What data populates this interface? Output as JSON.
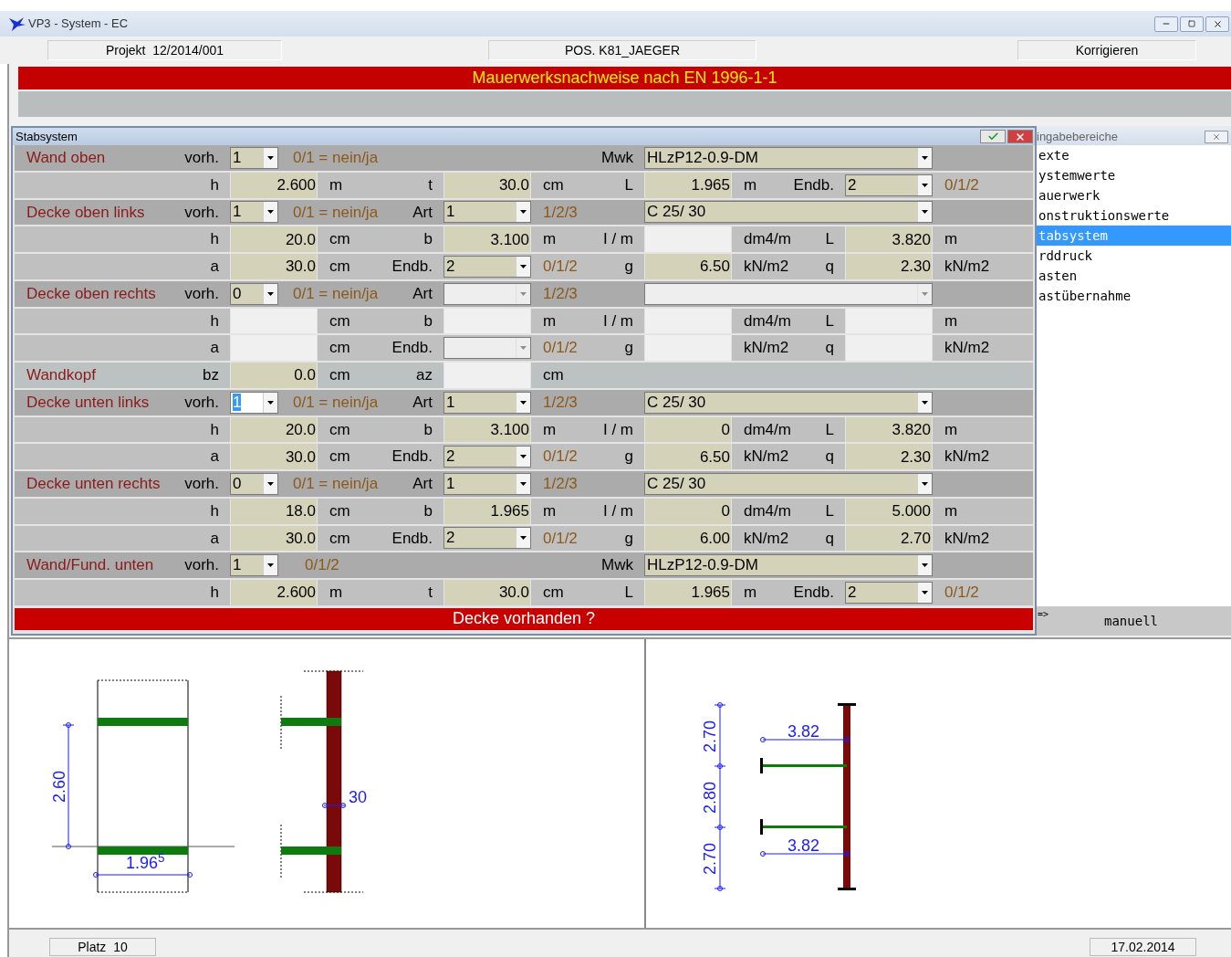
{
  "window": {
    "title": "VP3 - System - EC"
  },
  "info_fields": [
    "Projekt  12/2014/001",
    "POS. K81_JAEGER",
    "Korrigieren"
  ],
  "banner": "Mauerwerksnachweise nach EN 1996-1-1",
  "form": {
    "title": "Stabsystem",
    "rows": [
      {
        "kind": "header",
        "cells": [
          {
            "kind": "caption",
            "title": "Wand oben",
            "label": "vorh."
          },
          {
            "kind": "flag",
            "value": "1",
            "enabled": true,
            "focused": false
          },
          {
            "kind": "text",
            "hint": "0/1 = nein/ja"
          },
          {
            "kind": "blank"
          },
          {
            "kind": "text",
            "label": "Mwk"
          },
          {
            "kind": "material",
            "value": "HLzP12-0.9-DM",
            "enabled": true
          },
          {
            "kind": "blank"
          }
        ]
      },
      {
        "kind": "values",
        "cells": [
          {
            "kind": "caption",
            "label": "h"
          },
          {
            "kind": "input",
            "value": "2.600",
            "enabled": true
          },
          {
            "kind": "text",
            "unit": "m",
            "label": "t"
          },
          {
            "kind": "input",
            "value": "30.0",
            "enabled": true
          },
          {
            "kind": "text",
            "unit": "cm",
            "label": "L"
          },
          {
            "kind": "input",
            "value": "1.965",
            "enabled": true
          },
          {
            "kind": "text",
            "unit": "m",
            "label": "Endb."
          },
          {
            "kind": "combo",
            "value": "2",
            "enabled": true
          },
          {
            "kind": "text",
            "hint": "0/1/2"
          }
        ]
      },
      {
        "kind": "header",
        "cells": [
          {
            "kind": "caption",
            "title": "Decke oben links",
            "label": "vorh."
          },
          {
            "kind": "flag",
            "value": "1",
            "enabled": true,
            "focused": false
          },
          {
            "kind": "text",
            "hint": "0/1 = nein/ja",
            "label": "Art"
          },
          {
            "kind": "combo",
            "value": "1",
            "enabled": true
          },
          {
            "kind": "text",
            "hint": "1/2/3"
          },
          {
            "kind": "material",
            "value": "C 25/ 30",
            "enabled": true
          },
          {
            "kind": "blank"
          }
        ]
      },
      {
        "kind": "values",
        "cells": [
          {
            "kind": "caption",
            "label": "h"
          },
          {
            "kind": "input",
            "value": "20.0",
            "enabled": true
          },
          {
            "kind": "text",
            "unit": "cm",
            "label": "b"
          },
          {
            "kind": "input",
            "value": "3.100",
            "enabled": true
          },
          {
            "kind": "text",
            "unit": "m",
            "label": "I / m"
          },
          {
            "kind": "input",
            "enabled": false
          },
          {
            "kind": "text",
            "unit": "dm4/m",
            "label": "L"
          },
          {
            "kind": "input",
            "value": "3.820",
            "enabled": true
          },
          {
            "kind": "text",
            "unit": "m"
          }
        ]
      },
      {
        "kind": "values",
        "cells": [
          {
            "kind": "caption",
            "label": "a"
          },
          {
            "kind": "input",
            "value": "30.0",
            "enabled": true
          },
          {
            "kind": "text",
            "unit": "cm",
            "label": "Endb."
          },
          {
            "kind": "combo",
            "value": "2",
            "enabled": true
          },
          {
            "kind": "text",
            "hint": "0/1/2",
            "label": "g"
          },
          {
            "kind": "input",
            "value": "6.50",
            "enabled": true
          },
          {
            "kind": "text",
            "unit": "kN/m2",
            "label": "q"
          },
          {
            "kind": "input",
            "value": "2.30",
            "enabled": true
          },
          {
            "kind": "text",
            "unit": "kN/m2"
          }
        ]
      },
      {
        "kind": "header",
        "cells": [
          {
            "kind": "caption",
            "title": "Decke oben rechts",
            "label": "vorh."
          },
          {
            "kind": "flag",
            "value": "0",
            "enabled": true,
            "focused": false
          },
          {
            "kind": "text",
            "hint": "0/1 = nein/ja",
            "label": "Art"
          },
          {
            "kind": "combo",
            "enabled": false
          },
          {
            "kind": "text",
            "hint": "1/2/3"
          },
          {
            "kind": "material",
            "enabled": false
          },
          {
            "kind": "blank"
          }
        ]
      },
      {
        "kind": "values",
        "cells": [
          {
            "kind": "caption",
            "label": "h"
          },
          {
            "kind": "input",
            "enabled": false
          },
          {
            "kind": "text",
            "unit": "cm",
            "label": "b"
          },
          {
            "kind": "input",
            "enabled": false
          },
          {
            "kind": "text",
            "unit": "m",
            "label": "I / m"
          },
          {
            "kind": "input",
            "enabled": false
          },
          {
            "kind": "text",
            "unit": "dm4/m",
            "label": "L"
          },
          {
            "kind": "input",
            "enabled": false
          },
          {
            "kind": "text",
            "unit": "m"
          }
        ]
      },
      {
        "kind": "values",
        "cells": [
          {
            "kind": "caption",
            "label": "a"
          },
          {
            "kind": "input",
            "enabled": false
          },
          {
            "kind": "text",
            "unit": "cm",
            "label": "Endb."
          },
          {
            "kind": "combo",
            "enabled": false
          },
          {
            "kind": "text",
            "hint": "0/1/2",
            "label": "g"
          },
          {
            "kind": "input",
            "enabled": false
          },
          {
            "kind": "text",
            "unit": "kN/m2",
            "label": "q"
          },
          {
            "kind": "input",
            "enabled": false
          },
          {
            "kind": "text",
            "unit": "kN/m2"
          }
        ]
      },
      {
        "kind": "single",
        "cells": [
          {
            "kind": "caption",
            "title": "Wandkopf",
            "label": "bz"
          },
          {
            "kind": "input",
            "value": "0.0",
            "enabled": true
          },
          {
            "kind": "text",
            "unit": "cm",
            "label": "az"
          },
          {
            "kind": "input",
            "enabled": false
          },
          {
            "kind": "text",
            "unit": "cm"
          },
          {
            "kind": "blank"
          },
          {
            "kind": "blank"
          },
          {
            "kind": "blank"
          },
          {
            "kind": "blank"
          }
        ]
      },
      {
        "kind": "header",
        "cells": [
          {
            "kind": "caption",
            "title": "Decke unten links",
            "label": "vorh."
          },
          {
            "kind": "flag",
            "value": "1",
            "enabled": true,
            "focused": true
          },
          {
            "kind": "text",
            "hint": "0/1 = nein/ja",
            "label": "Art"
          },
          {
            "kind": "combo",
            "value": "1",
            "enabled": true
          },
          {
            "kind": "text",
            "hint": "1/2/3"
          },
          {
            "kind": "material",
            "value": "C 25/ 30",
            "enabled": true
          },
          {
            "kind": "blank"
          }
        ]
      },
      {
        "kind": "values",
        "cells": [
          {
            "kind": "caption",
            "label": "h"
          },
          {
            "kind": "input",
            "value": "20.0",
            "enabled": true
          },
          {
            "kind": "text",
            "unit": "cm",
            "label": "b"
          },
          {
            "kind": "input",
            "value": "3.100",
            "enabled": true
          },
          {
            "kind": "text",
            "unit": "m",
            "label": "I / m"
          },
          {
            "kind": "input",
            "value": "0",
            "enabled": true
          },
          {
            "kind": "text",
            "unit": "dm4/m",
            "label": "L"
          },
          {
            "kind": "input",
            "value": "3.820",
            "enabled": true
          },
          {
            "kind": "text",
            "unit": "m"
          }
        ]
      },
      {
        "kind": "values",
        "cells": [
          {
            "kind": "caption",
            "label": "a"
          },
          {
            "kind": "input",
            "value": "30.0",
            "enabled": true
          },
          {
            "kind": "text",
            "unit": "cm",
            "label": "Endb."
          },
          {
            "kind": "combo",
            "value": "2",
            "enabled": true
          },
          {
            "kind": "text",
            "hint": "0/1/2",
            "label": "g"
          },
          {
            "kind": "input",
            "value": "6.50",
            "enabled": true
          },
          {
            "kind": "text",
            "unit": "kN/m2",
            "label": "q"
          },
          {
            "kind": "input",
            "value": "2.30",
            "enabled": true
          },
          {
            "kind": "text",
            "unit": "kN/m2"
          }
        ]
      },
      {
        "kind": "header",
        "cells": [
          {
            "kind": "caption",
            "title": "Decke unten rechts",
            "label": "vorh."
          },
          {
            "kind": "flag",
            "value": "0",
            "enabled": true,
            "focused": false
          },
          {
            "kind": "text",
            "hint": "0/1 = nein/ja",
            "label": "Art"
          },
          {
            "kind": "combo",
            "value": "1",
            "enabled": true
          },
          {
            "kind": "text",
            "hint": "1/2/3"
          },
          {
            "kind": "material",
            "value": "C 25/ 30",
            "enabled": true
          },
          {
            "kind": "blank"
          }
        ]
      },
      {
        "kind": "values",
        "cells": [
          {
            "kind": "caption",
            "label": "h"
          },
          {
            "kind": "input",
            "value": "18.0",
            "enabled": true
          },
          {
            "kind": "text",
            "unit": "cm",
            "label": "b"
          },
          {
            "kind": "input",
            "value": "1.965",
            "enabled": true
          },
          {
            "kind": "text",
            "unit": "m",
            "label": "I / m"
          },
          {
            "kind": "input",
            "value": "0",
            "enabled": true
          },
          {
            "kind": "text",
            "unit": "dm4/m",
            "label": "L"
          },
          {
            "kind": "input",
            "value": "5.000",
            "enabled": true
          },
          {
            "kind": "text",
            "unit": "m"
          }
        ]
      },
      {
        "kind": "values",
        "cells": [
          {
            "kind": "caption",
            "label": "a"
          },
          {
            "kind": "input",
            "value": "30.0",
            "enabled": true
          },
          {
            "kind": "text",
            "unit": "cm",
            "label": "Endb."
          },
          {
            "kind": "combo",
            "value": "2",
            "enabled": true
          },
          {
            "kind": "text",
            "hint": "0/1/2",
            "label": "g"
          },
          {
            "kind": "input",
            "value": "6.00",
            "enabled": true
          },
          {
            "kind": "text",
            "unit": "kN/m2",
            "label": "q"
          },
          {
            "kind": "input",
            "value": "2.70",
            "enabled": true
          },
          {
            "kind": "text",
            "unit": "kN/m2"
          }
        ]
      },
      {
        "kind": "header",
        "cells": [
          {
            "kind": "caption",
            "title": "Wand/Fund. unten",
            "label": "vorh."
          },
          {
            "kind": "flag",
            "value": "1",
            "enabled": true,
            "focused": false
          },
          {
            "kind": "text",
            "hint": "0/1/2"
          },
          {
            "kind": "blank"
          },
          {
            "kind": "text",
            "label": "Mwk"
          },
          {
            "kind": "material",
            "value": "HLzP12-0.9-DM",
            "enabled": true
          },
          {
            "kind": "blank"
          }
        ]
      },
      {
        "kind": "values",
        "cells": [
          {
            "kind": "caption",
            "label": "h"
          },
          {
            "kind": "input",
            "value": "2.600",
            "enabled": true
          },
          {
            "kind": "text",
            "unit": "m",
            "label": "t"
          },
          {
            "kind": "input",
            "value": "30.0",
            "enabled": true
          },
          {
            "kind": "text",
            "unit": "cm",
            "label": "L"
          },
          {
            "kind": "input",
            "value": "1.965",
            "enabled": true
          },
          {
            "kind": "text",
            "unit": "m",
            "label": "Endb."
          },
          {
            "kind": "combo",
            "value": "2",
            "enabled": true
          },
          {
            "kind": "text",
            "hint": "0/1/2"
          }
        ]
      }
    ],
    "message": "Decke vorhanden ?"
  },
  "sidebar": {
    "title": "ingabebereiche",
    "items": [
      {
        "label": "exte",
        "selected": false
      },
      {
        "label": "ystemwerte",
        "selected": false
      },
      {
        "label": "auerwerk",
        "selected": false
      },
      {
        "label": "onstruktionswerte",
        "selected": false
      },
      {
        "label": "tabsystem",
        "selected": true
      },
      {
        "label": "rddruck",
        "selected": false
      },
      {
        "label": "asten",
        "selected": false
      },
      {
        "label": "astübernahme",
        "selected": false
      }
    ],
    "arrow": "=>",
    "mode": "manuell"
  },
  "diagrams": [
    {
      "labels": [
        "2.60",
        "1.96$^{5}$",
        "30"
      ]
    },
    {
      "labels": [
        "2.70",
        "2.80",
        "2.70",
        "3.82",
        "3.82"
      ]
    }
  ],
  "status_bar": {
    "place": "Platz  10",
    "date": "17.02.2014"
  }
}
